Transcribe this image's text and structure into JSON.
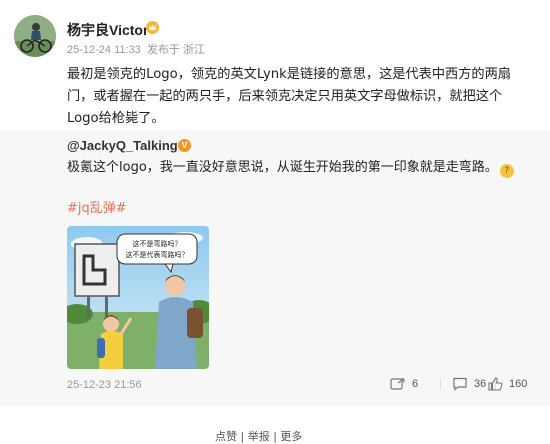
{
  "post": {
    "author": "杨宇良Victor",
    "timestamp": "25-12-24 11:33",
    "source": "发布于 浙江",
    "body": "最初是领克的Logo，领克的英文Lynk是链接的意思，这是代表中西方的两扇门，或者握在一起的两只手，后来领克决定只用英文字母做标识，就把这个Logo给枪毙了。"
  },
  "repost": {
    "author": "@JackyQ_Talking",
    "verified_badge": "V",
    "text": "极氪这个logo，我一直没好意思说，从诞生开始我的第一印象就是走弯路。",
    "emoji_name": "thinking-face-icon",
    "hashtag": "#jq乱弹#",
    "image_bubble_line1": "这不是弯路吗？",
    "image_bubble_line2": "这不是代表弯路吗？",
    "timestamp": "25-12-23 21:56",
    "actions": {
      "forward_count": "6",
      "comment_count": "36",
      "like_count": "160"
    }
  },
  "footer": {
    "partial_text": "点赞 | 举报 | 更多"
  },
  "colors": {
    "accent": "#eb7350",
    "badge": "#f7931e",
    "repost_bg": "#f7f7f7"
  }
}
